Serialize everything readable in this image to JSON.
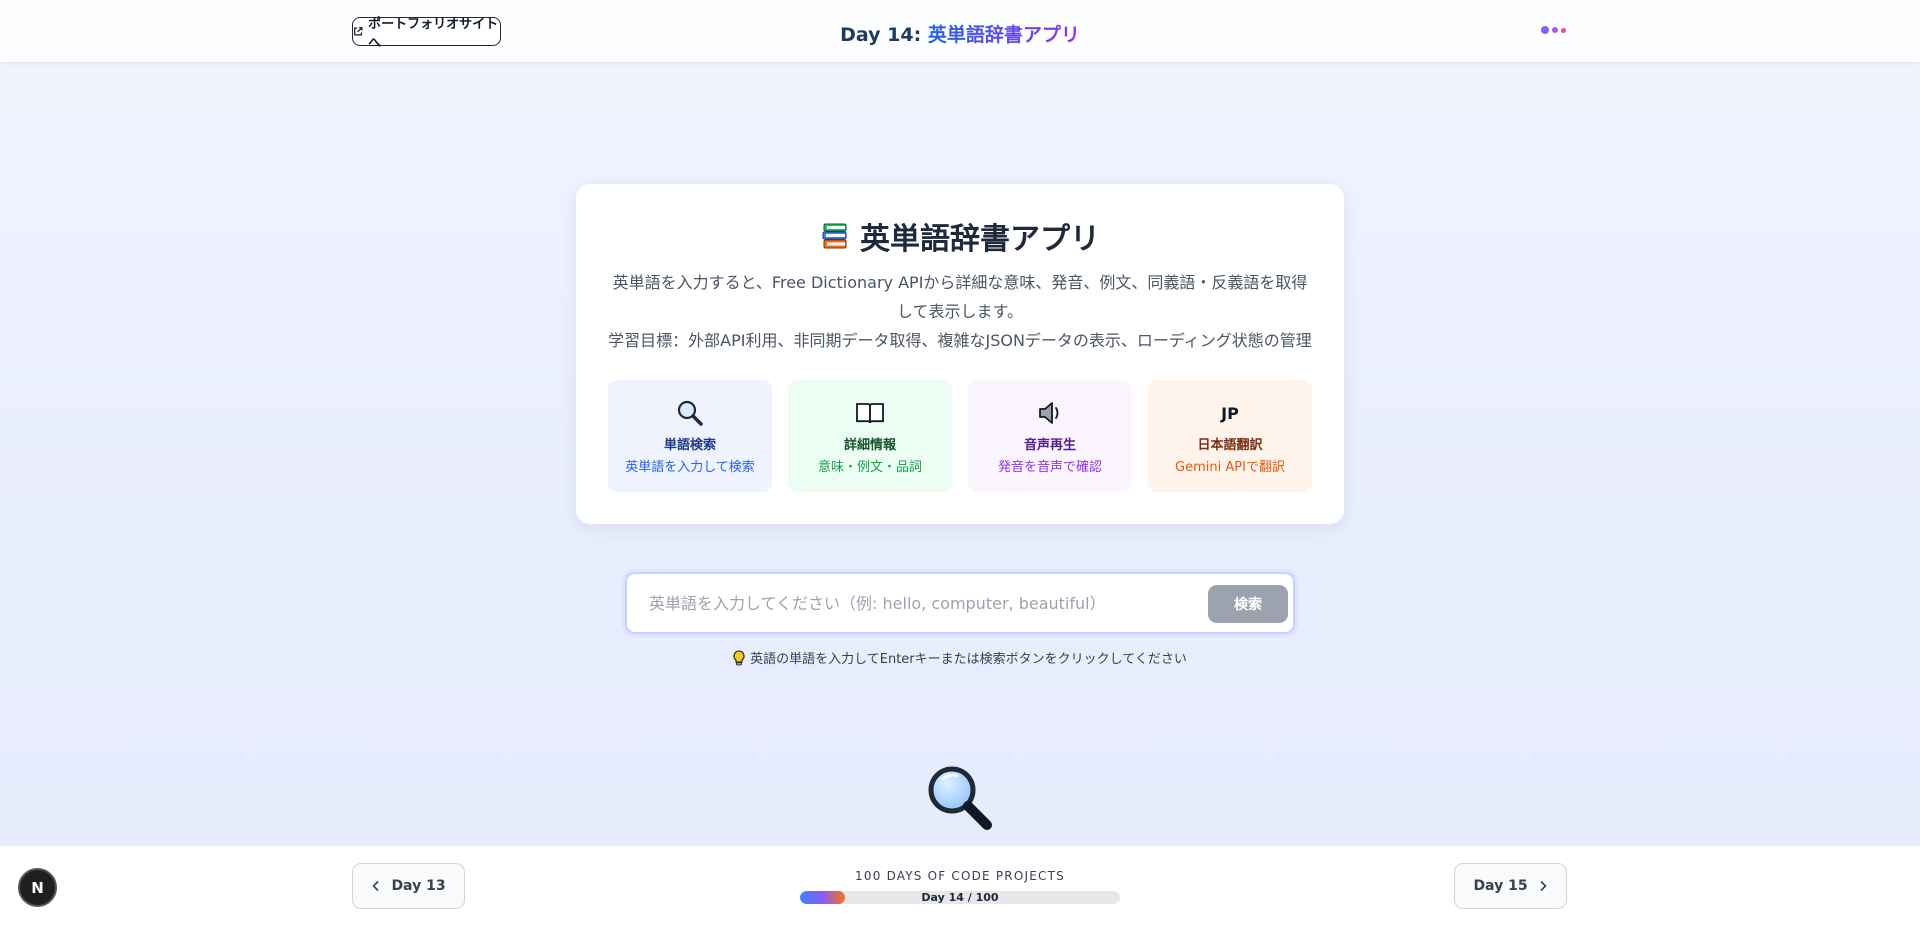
{
  "header": {
    "portfolio_label": "ポートフォリオサイトへ",
    "title_day": "Day 14: ",
    "title_name": "英単語辞書アプリ"
  },
  "card": {
    "title": "英単語辞書アプリ",
    "description_1": "英単語を入力すると、Free Dictionary APIから詳細な意味、発音、例文、同義語・反義語を取得して表示します。",
    "description_2": "学習目標：外部API利用、非同期データ取得、複雑なJSONデータの表示、ローディング状態の管理",
    "features": [
      {
        "icon": "search-icon",
        "title": "単語検索",
        "sub": "英単語を入力して検索"
      },
      {
        "icon": "book-icon",
        "title": "詳細情報",
        "sub": "意味・例文・品詞"
      },
      {
        "icon": "speaker-icon",
        "title": "音声再生",
        "sub": "発音を音声で確認"
      },
      {
        "icon": "jp-text",
        "icon_text": "JP",
        "title": "日本語翻訳",
        "sub": "Gemini APIで翻訳"
      }
    ]
  },
  "search": {
    "value": "",
    "placeholder": "英単語を入力してください（例: hello, computer, beautiful）",
    "button_label": "検索"
  },
  "hint": "英語の単語を入力してEnterキーまたは検索ボタンをクリックしてください",
  "footer": {
    "prev_label": "Day 13",
    "next_label": "Day 15",
    "progress_label": "100 DAYS OF CODE PROJECTS",
    "progress_text": "Day 14 / 100",
    "progress_value": 14,
    "progress_max": 100
  },
  "logo_letter": "N",
  "colors": {
    "accent_blue": "#2563eb",
    "accent_purple": "#9333ea",
    "button_gray": "#9ca3af"
  }
}
